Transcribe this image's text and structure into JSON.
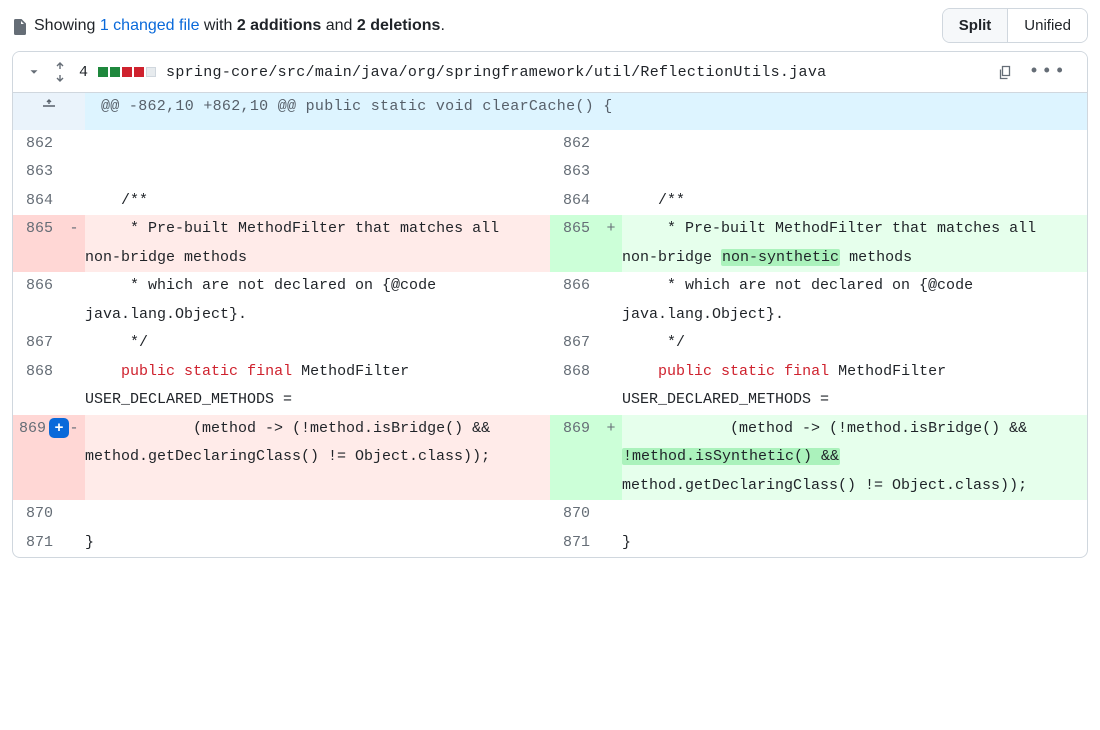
{
  "summary": {
    "prefix": "Showing ",
    "files_link": "1 changed file",
    "mid": " with ",
    "additions": "2 additions",
    "and": " and ",
    "deletions": "2 deletions",
    "suffix": "."
  },
  "view_toggle": {
    "split": "Split",
    "unified": "Unified",
    "active": "split"
  },
  "file": {
    "change_count": "4",
    "diffstat": [
      "add",
      "add",
      "del",
      "del",
      "neutral"
    ],
    "path": "spring-core/src/main/java/org/springframework/util/ReflectionUtils.java",
    "hunk_header": "@@ -862,10 +862,10 @@ public static void clearCache() {"
  },
  "rows": {
    "l862": "862",
    "r862": "862",
    "c862": "",
    "l863": "863",
    "r863": "863",
    "c863": "",
    "l864": "864",
    "r864": "864",
    "c864": "    /**",
    "l865": "865",
    "r865": "865",
    "doc_del": "     * Pre-built MethodFilter that matches all non-bridge methods",
    "doc_add_pre": "     * Pre-built MethodFilter that matches all non-bridge ",
    "doc_add_hl": "non-synthetic",
    "doc_add_post": " methods",
    "l866": "866",
    "r866": "866",
    "c866": "     * which are not declared on {@code java.lang.Object}.",
    "l867": "867",
    "r867": "867",
    "c867": "     */",
    "l868": "868",
    "r868": "868",
    "decl_kw1": "public",
    "decl_kw2": "static",
    "decl_kw3": "final",
    "decl_rest": " MethodFilter USER_DECLARED_METHODS =",
    "decl_indent": "    ",
    "l869": "869",
    "r869": "869",
    "body_del": "            (method -> (!method.isBridge() && method.getDeclaringClass() != Object.class));",
    "body_add_a": "            (method -> (!method.isBridge() && ",
    "body_add_hl": "!method.isSynthetic() &&",
    "body_add_b": " method.getDeclaringClass() != Object.class));",
    "l870": "870",
    "r870": "870",
    "c870": "",
    "l871": "871",
    "r871": "871",
    "c871": "}",
    "minus": "-",
    "plus": "+"
  }
}
